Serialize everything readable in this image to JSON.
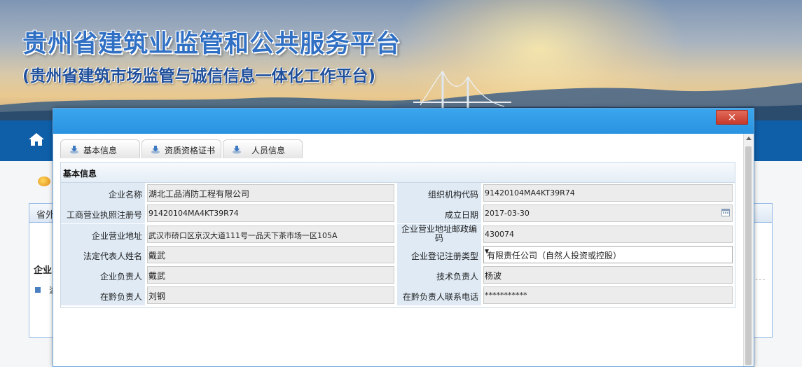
{
  "banner": {
    "title": "贵州省建筑业监管和公共服务平台",
    "subtitle": "(贵州省建筑市场监管与诚信信息一体化工作平台)"
  },
  "background": {
    "panel_tab": "省外",
    "section_title": "企业",
    "list_item": "湖"
  },
  "modal": {
    "close_label": "×",
    "tabs": [
      {
        "label": "基本信息"
      },
      {
        "label": "资质资格证书"
      },
      {
        "label": "人员信息"
      }
    ],
    "section_title": "基本信息",
    "fields": {
      "company_name": {
        "label": "企业名称",
        "value": "湖北工品消防工程有限公司"
      },
      "org_code": {
        "label": "组织机构代码",
        "value": "91420104MA4KT39R74"
      },
      "business_license": {
        "label": "工商营业执照注册号",
        "value": "91420104MA4KT39R74"
      },
      "established_date": {
        "label": "成立日期",
        "value": "2017-03-30"
      },
      "business_address": {
        "label": "企业营业地址",
        "value": "武汉市硚口区京汉大道111号一品天下茶市场一区105A"
      },
      "postal_code": {
        "label": "企业营业地址邮政编码",
        "value": "430074"
      },
      "legal_rep": {
        "label": "法定代表人姓名",
        "value": "戴武"
      },
      "registration_type": {
        "label": "企业登记注册类型",
        "value": "有限责任公司（自然人投资或控股）"
      },
      "company_head": {
        "label": "企业负责人",
        "value": "戴武"
      },
      "tech_head": {
        "label": "技术负责人",
        "value": "杨波"
      },
      "guizhou_head": {
        "label": "在黔负责人",
        "value": "刘钢"
      },
      "guizhou_phone": {
        "label": "在黔负责人联系电话",
        "value": "***********"
      }
    }
  },
  "colors": {
    "navbar": "#0e5ea8",
    "modal_titlebar": "#2a93e0",
    "close_button": "#c53a2b",
    "label_bg": "#dfeaf5"
  }
}
